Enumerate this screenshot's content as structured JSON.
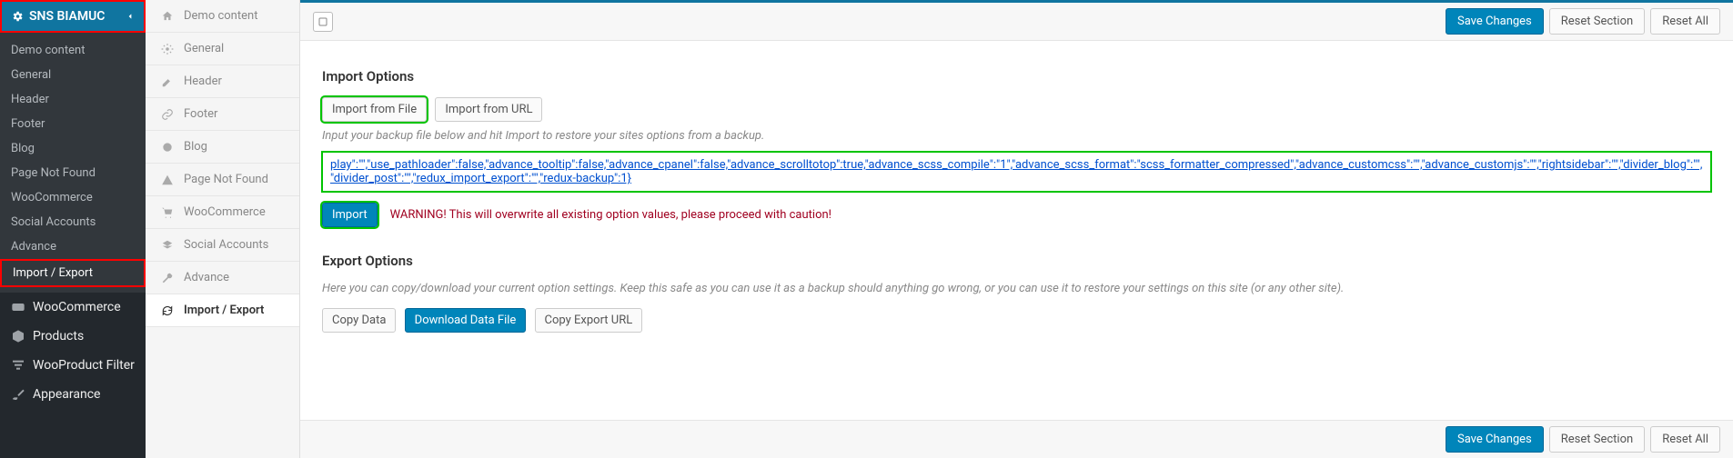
{
  "sidebar_left": {
    "theme_label": "SNS BIAMUC",
    "submenu": [
      "Demo content",
      "General",
      "Header",
      "Footer",
      "Blog",
      "Page Not Found",
      "WooCommerce",
      "Social Accounts",
      "Advance",
      "Import / Export"
    ],
    "active_submenu_index": 9,
    "main_menu": [
      {
        "label": "WooCommerce",
        "icon": "woocommerce-icon"
      },
      {
        "label": "Products",
        "icon": "box-icon"
      },
      {
        "label": "WooProduct Filter",
        "icon": "filter-icon"
      },
      {
        "label": "Appearance",
        "icon": "brush-icon"
      }
    ]
  },
  "sidebar_tabs": {
    "items": [
      {
        "label": "Demo content",
        "icon": "home-icon"
      },
      {
        "label": "General",
        "icon": "gear-icon"
      },
      {
        "label": "Header",
        "icon": "pencil-icon"
      },
      {
        "label": "Footer",
        "icon": "link-icon"
      },
      {
        "label": "Blog",
        "icon": "gear-icon"
      },
      {
        "label": "Page Not Found",
        "icon": "warning-icon"
      },
      {
        "label": "WooCommerce",
        "icon": "cart-icon"
      },
      {
        "label": "Social Accounts",
        "icon": "layers-icon"
      },
      {
        "label": "Advance",
        "icon": "wrench-icon"
      },
      {
        "label": "Import / Export",
        "icon": "refresh-icon"
      }
    ],
    "active_index": 9
  },
  "topbar": {
    "save_label": "Save Changes",
    "reset_section_label": "Reset Section",
    "reset_all_label": "Reset All"
  },
  "import": {
    "heading": "Import Options",
    "from_file_label": "Import from File",
    "from_url_label": "Import from URL",
    "hint": "Input your backup file below and hit Import to restore your sites options from a backup.",
    "textarea_value": "play\":\"\",\"use_pathloader\":false,\"advance_tooltip\":false,\"advance_cpanel\":false,\"advance_scrolltotop\":true,\"advance_scss_compile\":\"1\",\"advance_scss_format\":\"scss_formatter_compressed\",\"advance_customcss\":\"\",\"advance_customjs\":\"\",\"rightsidebar\":\"\",\"divider_blog\":\"\",\"divider_post\":\"\",\"redux_import_export\":\"\",\"redux-backup\":1}",
    "button_label": "Import",
    "warning": "WARNING! This will overwrite all existing option values, please proceed with caution!"
  },
  "export": {
    "heading": "Export Options",
    "description": "Here you can copy/download your current option settings. Keep this safe as you can use it as a backup should anything go wrong, or you can use it to restore your settings on this site (or any other site).",
    "copy_label": "Copy Data",
    "download_label": "Download Data File",
    "copy_url_label": "Copy Export URL"
  },
  "colors": {
    "primary": "#0085ba",
    "danger": "#a00020",
    "highlight": "#00c400"
  }
}
